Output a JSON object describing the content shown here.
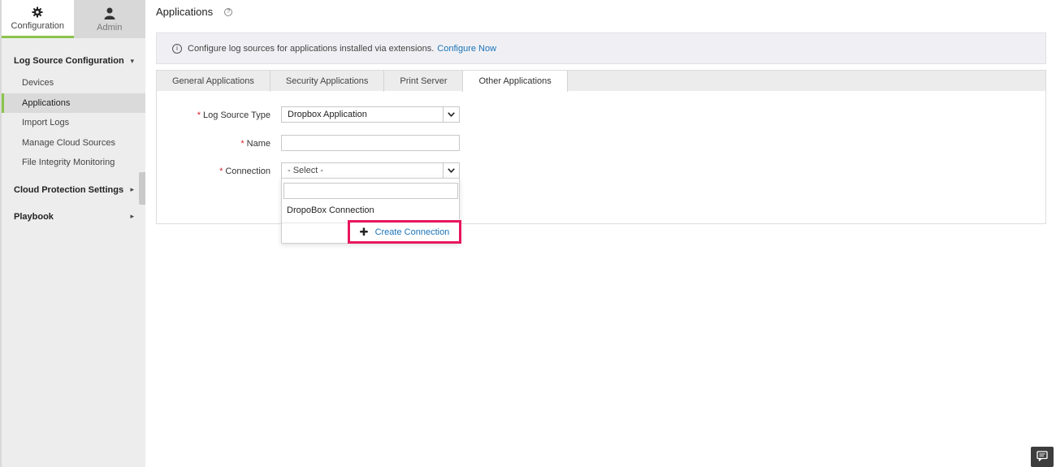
{
  "topnav": {
    "configuration_label": "Configuration",
    "admin_label": "Admin"
  },
  "sidebar": {
    "group1_label": "Log Source Configuration",
    "items": [
      {
        "label": "Devices"
      },
      {
        "label": "Applications"
      },
      {
        "label": "Import Logs"
      },
      {
        "label": "Manage Cloud Sources"
      },
      {
        "label": "File Integrity Monitoring"
      }
    ],
    "group2_label": "Cloud Protection Settings",
    "group3_label": "Playbook"
  },
  "page": {
    "title": "Applications",
    "help_glyph": "?"
  },
  "info_bar": {
    "text": "Configure log sources for applications installed via extensions.",
    "link": "Configure Now"
  },
  "tabs": [
    {
      "label": "General Applications"
    },
    {
      "label": "Security Applications"
    },
    {
      "label": "Print Server"
    },
    {
      "label": "Other Applications"
    }
  ],
  "form": {
    "required_mark": "*",
    "log_source_type_label": "Log Source Type",
    "log_source_type_value": "Dropbox Application",
    "name_label": "Name",
    "name_value": "",
    "connection_label": "Connection",
    "connection_value": "- Select -"
  },
  "dropdown": {
    "search_value": "",
    "options": [
      "DropoBox Connection"
    ],
    "create_label": "Create Connection"
  },
  "colors": {
    "accent_green": "#8bc34a",
    "link_blue": "#1a73b8",
    "highlight_pink": "#e8175d",
    "required_red": "#d9232e"
  }
}
